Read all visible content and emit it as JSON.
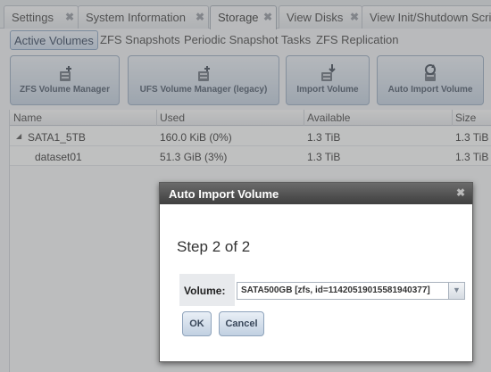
{
  "tabs": [
    {
      "label": "Settings",
      "close": "✖"
    },
    {
      "label": "System Information",
      "close": "✖"
    },
    {
      "label": "Storage",
      "close": "✖"
    },
    {
      "label": "View Disks",
      "close": "✖"
    },
    {
      "label": "View Init/Shutdown Scri",
      "close": ""
    }
  ],
  "subtabs": [
    "Active Volumes",
    "ZFS Snapshots",
    "Periodic Snapshot Tasks",
    "ZFS Replication"
  ],
  "toolbar": {
    "zfs_manager": "ZFS Volume Manager",
    "ufs_manager": "UFS Volume Manager (legacy)",
    "import_volume": "Import Volume",
    "auto_import": "Auto Import Volume"
  },
  "grid": {
    "columns": [
      "Name",
      "Used",
      "Available",
      "Size"
    ],
    "rows": [
      {
        "expander": "◢",
        "name": "SATA1_5TB",
        "used": "160.0 KiB (0%)",
        "available": "1.3 TiB",
        "size": "1.3 TiB"
      },
      {
        "expander": "",
        "name": "dataset01",
        "used": "51.3 GiB (3%)",
        "available": "1.3 TiB",
        "size": "1.3 TiB"
      }
    ]
  },
  "dialog": {
    "title": "Auto Import Volume",
    "close": "✖",
    "step": "Step 2 of 2",
    "volume_label": "Volume:",
    "volume_value": "SATA500GB [zfs, id=11420519015581940377]",
    "arrow": "▼",
    "ok": "OK",
    "cancel": "Cancel"
  },
  "colors": {
    "overlay": "#787878",
    "dialog_title": "#4a4a4a",
    "accent": "#c6d6ea"
  }
}
